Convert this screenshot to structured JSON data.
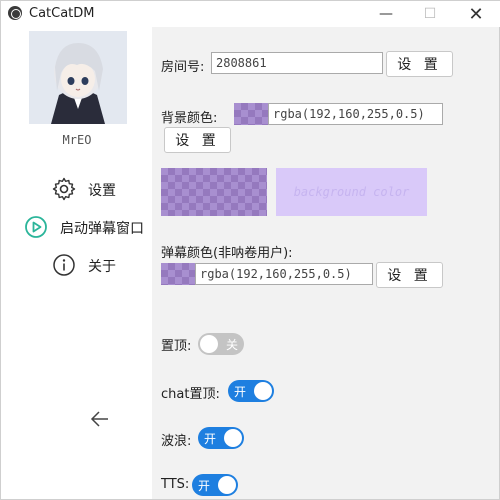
{
  "window": {
    "title": "CatCatDM",
    "minimize_label": "—",
    "maximize_label": "☐",
    "close_label": "✕"
  },
  "sidebar": {
    "username": "MrEO",
    "items": [
      {
        "label": "设置",
        "icon": "gear-icon"
      },
      {
        "label": "启动弹幕窗口",
        "icon": "play-circle-icon"
      },
      {
        "label": "关于",
        "icon": "info-icon"
      }
    ],
    "back_icon": "back-arrow-icon"
  },
  "settings": {
    "room_label": "房间号:",
    "room_value": "2808861",
    "set_label": "设 置",
    "bg_color_label": "背景颜色:",
    "bg_color_value": "rgba(192,160,255,0.5)",
    "preview_text": "background color",
    "danmaku_color_label": "弹幕颜色(非呐卷用户):",
    "danmaku_color_value": "rgba(192,160,255,0.5)",
    "pin_label": "置顶:",
    "pin_state": "关",
    "chat_pin_label": "chat置顶:",
    "chat_pin_state": "开",
    "wave_label": "波浪:",
    "wave_state": "开",
    "tts_label": "TTS:",
    "tts_state": "开"
  },
  "colors": {
    "accent": "#1e7fe0",
    "preview": "rgba(192,160,255,0.5)",
    "play_icon": "#2bb59a"
  }
}
